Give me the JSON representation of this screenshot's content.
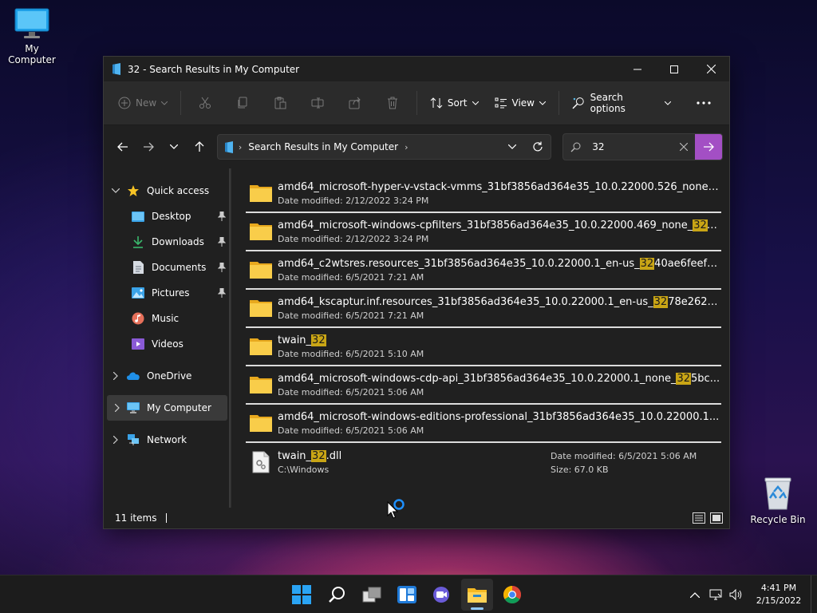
{
  "desktop": {
    "icons": [
      {
        "label": "My Computer"
      },
      {
        "label": "Recycle Bin"
      }
    ]
  },
  "window": {
    "title": "32 - Search Results in My Computer",
    "toolbar": {
      "new_label": "New",
      "sort_label": "Sort",
      "view_label": "View",
      "search_options_label": "Search options"
    },
    "address": {
      "crumb": "Search Results in My Computer"
    },
    "search": {
      "value": "32"
    },
    "nav": {
      "quick_access": "Quick access",
      "desktop": "Desktop",
      "downloads": "Downloads",
      "documents": "Documents",
      "pictures": "Pictures",
      "music": "Music",
      "videos": "Videos",
      "onedrive": "OneDrive",
      "my_computer": "My Computer",
      "network": "Network"
    },
    "results": [
      {
        "pre": "amd64_microsoft-hyper-v-vstack-vmms_31bf3856ad364e35_10.0.22000.526_none_...",
        "hl": "",
        "post": "",
        "date": "Date modified: 2/12/2022 3:24 PM"
      },
      {
        "pre": "amd64_microsoft-windows-cpfilters_31bf3856ad364e35_10.0.22000.469_none_",
        "hl": "32",
        "post": "a...",
        "date": "Date modified: 2/12/2022 3:24 PM"
      },
      {
        "pre": "amd64_c2wtsres.resources_31bf3856ad364e35_10.0.22000.1_en-us_",
        "hl": "32",
        "post": "40ae6feef3fd...",
        "date": "Date modified: 6/5/2021 7:21 AM"
      },
      {
        "pre": "amd64_kscaptur.inf.resources_31bf3856ad364e35_10.0.22000.1_en-us_",
        "hl": "32",
        "post": "78e26269...",
        "date": "Date modified: 6/5/2021 7:21 AM"
      },
      {
        "pre": "twain_",
        "hl": "32",
        "post": "",
        "date": "Date modified: 6/5/2021 5:10 AM"
      },
      {
        "pre": "amd64_microsoft-windows-cdp-api_31bf3856ad364e35_10.0.22000.1_none_",
        "hl": "32",
        "post": "5bc...",
        "date": "Date modified: 6/5/2021 5:06 AM"
      },
      {
        "pre": "amd64_microsoft-windows-editions-professional_31bf3856ad364e35_10.0.22000.1...",
        "hl": "",
        "post": "",
        "date": "Date modified: 6/5/2021 5:06 AM"
      }
    ],
    "file_result": {
      "pre": "twain_",
      "hl": "32",
      "post": ".dll",
      "path": "C:\\Windows",
      "date": "Date modified: 6/5/2021 5:06 AM",
      "size": "Size: 67.0 KB"
    },
    "status": {
      "items": "11 items"
    }
  },
  "taskbar": {
    "time": "4:41 PM",
    "date": "2/15/2022"
  },
  "colors": {
    "accent": "#a34fc4",
    "highlight": "#c9a515",
    "folder": "#f5c542"
  }
}
